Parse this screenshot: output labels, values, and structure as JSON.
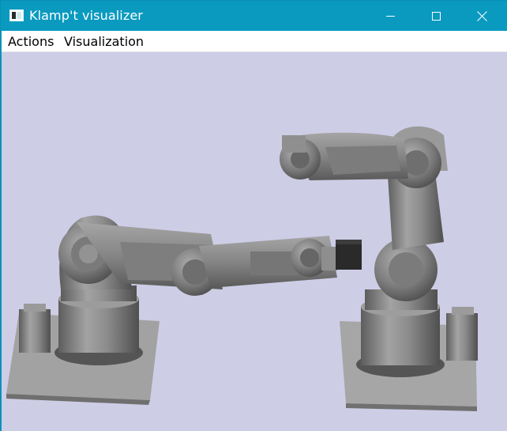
{
  "window": {
    "title": "Klamp't visualizer",
    "controls": {
      "minimize": "minimize-icon",
      "maximize": "maximize-icon",
      "close": "close-icon"
    }
  },
  "menubar": {
    "items": [
      {
        "label": "Actions"
      },
      {
        "label": "Visualization"
      }
    ]
  },
  "viewport": {
    "background_color": "#cdcde6",
    "robot_color": "#8a8a8a",
    "gripper_color": "#2a2a2a"
  }
}
